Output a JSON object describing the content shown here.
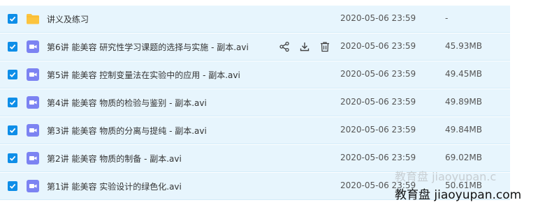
{
  "colors": {
    "row_background": "#e7f5fd",
    "checkbox": "#0e8ee8",
    "folder": "#fcc43e",
    "video": "#7c83f2"
  },
  "files": [
    {
      "icon": "folder-icon",
      "name": "讲义及练习",
      "modified": "2020-05-06 23:59",
      "size": "-",
      "checked": true
    },
    {
      "icon": "video-file-icon",
      "name": "第6讲 能美容 研究性学习课题的选择与实施 - 副本.avi",
      "modified": "2020-05-06 23:59",
      "size": "45.93MB",
      "checked": true,
      "hover_actions": [
        "share-icon",
        "download-icon",
        "delete-icon"
      ]
    },
    {
      "icon": "video-file-icon",
      "name": "第5讲 能美容 控制变量法在实验中的应用 - 副本.avi",
      "modified": "2020-05-06 23:59",
      "size": "49.45MB",
      "checked": true
    },
    {
      "icon": "video-file-icon",
      "name": "第4讲 能美容 物质的检验与鉴别 - 副本.avi",
      "modified": "2020-05-06 23:59",
      "size": "49.89MB",
      "checked": true
    },
    {
      "icon": "video-file-icon",
      "name": "第3讲 能美容 物质的分离与提纯 - 副本.avi",
      "modified": "2020-05-06 23:59",
      "size": "49.84MB",
      "checked": true
    },
    {
      "icon": "video-file-icon",
      "name": "第2讲 能美容 物质的制备 - 副本.avi",
      "modified": "2020-05-06 23:59",
      "size": "69.02MB",
      "checked": true
    },
    {
      "icon": "video-file-icon",
      "name": "第1讲 能美容 实验设计的绿色化.avi",
      "modified": "2020-05-06 23:59",
      "size": "50.61MB",
      "checked": true
    }
  ],
  "watermark": "教育盘 jiaoyupan.com",
  "watermark_faint": "教育盘 jiaoyupan.c"
}
